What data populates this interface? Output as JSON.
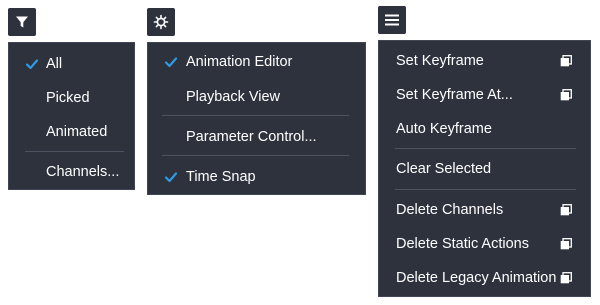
{
  "toolbar": {
    "filter_button": {
      "icon": "filter-icon"
    },
    "settings_button": {
      "icon": "gear-icon"
    },
    "menu_button": {
      "icon": "hamburger-icon"
    }
  },
  "filter_menu": {
    "items": [
      {
        "label": "All",
        "checked": true
      },
      {
        "label": "Picked",
        "checked": false
      },
      {
        "label": "Animated",
        "checked": false
      },
      {
        "label": "Channels...",
        "checked": false
      }
    ]
  },
  "settings_menu": {
    "items": [
      {
        "label": "Animation Editor",
        "checked": true
      },
      {
        "label": "Playback View",
        "checked": false
      },
      {
        "label": "Parameter Control...",
        "checked": false
      },
      {
        "label": "Time Snap",
        "checked": true
      }
    ]
  },
  "actions_menu": {
    "items": [
      {
        "label": "Set Keyframe",
        "has_options": true
      },
      {
        "label": "Set Keyframe At...",
        "has_options": true
      },
      {
        "label": "Auto Keyframe",
        "has_options": false
      },
      {
        "label": "Clear Selected",
        "has_options": false
      },
      {
        "label": "Delete Channels",
        "has_options": true
      },
      {
        "label": "Delete Static Actions",
        "has_options": true
      },
      {
        "label": "Delete Legacy Animation",
        "has_options": true
      }
    ]
  },
  "colors": {
    "menu_bg": "#2d323d",
    "check": "#2f9be2",
    "text": "#ffffff",
    "separator": "#4b5261"
  }
}
